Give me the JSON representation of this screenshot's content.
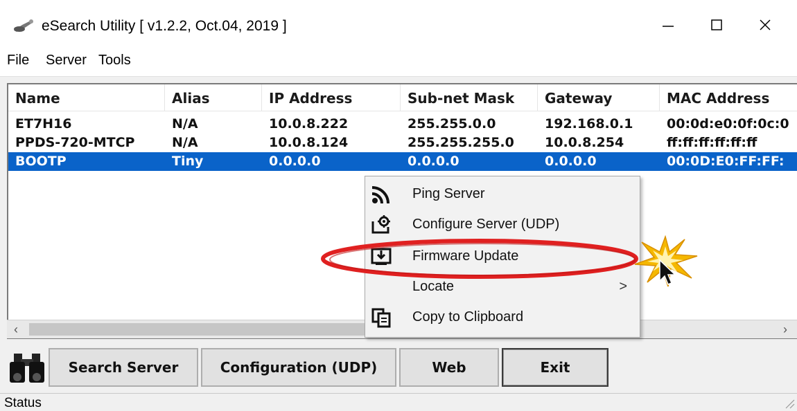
{
  "window": {
    "title": "eSearch Utility [ v1.2.2, Oct.04, 2019 ]"
  },
  "menu": {
    "file": "File",
    "server": "Server",
    "tools": "Tools"
  },
  "columns": [
    "Name",
    "Alias",
    "IP Address",
    "Sub-net Mask",
    "Gateway",
    "MAC Address"
  ],
  "rows": [
    {
      "name": "ET7H16",
      "alias": "N/A",
      "ip": "10.0.8.222",
      "mask": "255.255.0.0",
      "gateway": "192.168.0.1",
      "mac": "00:0d:e0:0f:0c:0",
      "selected": false
    },
    {
      "name": "PPDS-720-MTCP",
      "alias": "N/A",
      "ip": "10.0.8.124",
      "mask": "255.255.255.0",
      "gateway": "10.0.8.254",
      "mac": "ff:ff:ff:ff:ff:ff",
      "selected": false
    },
    {
      "name": "BOOTP",
      "alias": "Tiny",
      "ip": "0.0.0.0",
      "mask": "0.0.0.0",
      "gateway": "0.0.0.0",
      "mac": "00:0D:E0:FF:FF:",
      "selected": true
    }
  ],
  "context_menu": {
    "items": [
      {
        "label": "Ping Server",
        "icon": "signal-icon"
      },
      {
        "label": "Configure Server (UDP)",
        "icon": "configure-icon"
      },
      {
        "label": "Firmware Update",
        "icon": "download-icon"
      },
      {
        "label": "Locate",
        "icon": "",
        "submenu_arrow": ">"
      },
      {
        "label": "Copy to Clipboard",
        "icon": "clipboard-icon"
      }
    ]
  },
  "buttons": {
    "search": "Search Server",
    "config": "Configuration (UDP)",
    "web": "Web",
    "exit": "Exit"
  },
  "status": {
    "text": "Status"
  },
  "colors": {
    "selection": "#0a63c9",
    "highlight_ellipse": "#e02020",
    "burst": "#f5b800"
  }
}
